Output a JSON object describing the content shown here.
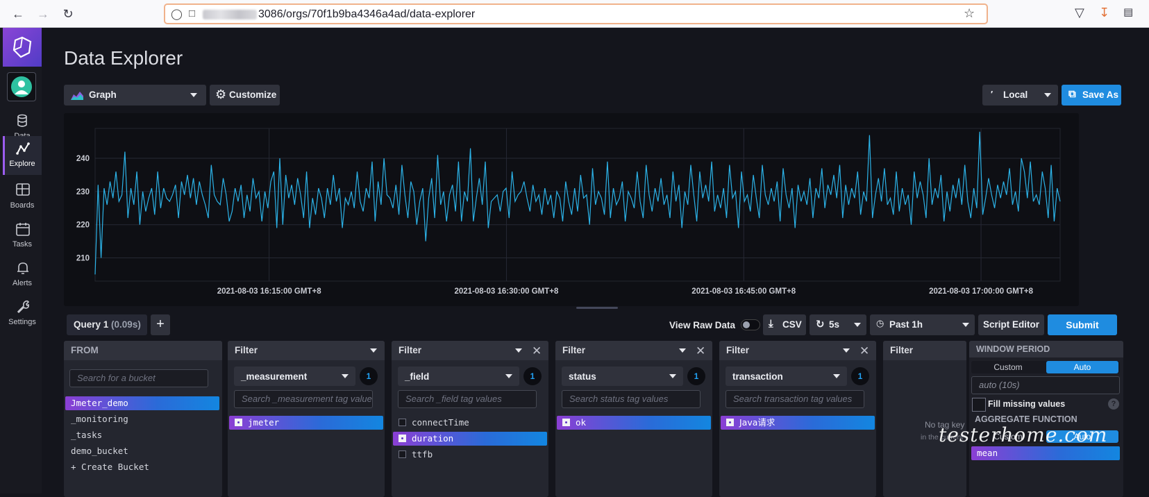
{
  "browser": {
    "url_rest": "3086/orgs/70f1b9ba4346a4ad/data-explorer"
  },
  "sidebar": {
    "items": [
      {
        "label": "Data"
      },
      {
        "label": "Explore"
      },
      {
        "label": "Boards"
      },
      {
        "label": "Tasks"
      },
      {
        "label": "Alerts"
      },
      {
        "label": "Settings"
      }
    ]
  },
  "header": {
    "title": "Data Explorer",
    "graph_type": "Graph",
    "customize": "Customize",
    "timezone": "Local",
    "save_as": "Save As"
  },
  "chart_data": {
    "type": "line",
    "y_ticks": [
      "210",
      "220",
      "230",
      "240"
    ],
    "x_ticks": [
      "2021-08-03 16:15:00 GMT+8",
      "2021-08-03 16:30:00 GMT+8",
      "2021-08-03 16:45:00 GMT+8",
      "2021-08-03 17:00:00 GMT+8"
    ],
    "ylim": [
      203,
      249
    ],
    "x_start": "2021-08-03 16:04:00 GMT+8",
    "x_end": "2021-08-03 17:05:00 GMT+8",
    "series": [
      {
        "color": "#2cb3e8",
        "values": [
          205,
          232,
          210,
          231,
          226,
          233,
          228,
          236,
          227,
          229,
          242,
          222,
          231,
          226,
          236,
          220,
          230,
          224,
          228,
          231,
          223,
          236,
          225,
          231,
          228,
          227,
          229,
          232,
          222,
          233,
          229,
          235,
          228,
          234,
          226,
          233,
          229,
          226,
          222,
          238,
          229,
          227,
          226,
          234,
          229,
          221,
          224,
          231,
          227,
          232,
          222,
          229,
          224,
          234,
          228,
          230,
          221,
          230,
          225,
          233,
          236,
          219,
          240,
          220,
          235,
          228,
          232,
          226,
          234,
          229,
          222,
          236,
          219,
          228,
          223,
          231,
          228,
          222,
          231,
          226,
          235,
          227,
          231,
          219,
          228,
          226,
          230,
          225,
          236,
          227,
          224,
          231,
          228,
          239,
          221,
          233,
          226,
          240,
          229,
          228,
          225,
          232,
          223,
          238,
          229,
          222,
          233,
          230,
          220,
          227,
          231,
          215,
          228,
          234,
          222,
          241,
          226,
          230,
          221,
          229,
          232,
          224,
          239,
          221,
          230,
          227,
          243,
          221,
          228,
          234,
          226,
          239,
          219,
          227,
          228,
          229,
          224,
          230,
          231,
          222,
          236,
          227,
          229,
          230,
          233,
          228,
          224,
          232,
          227,
          229,
          223,
          231,
          226,
          229,
          222,
          230,
          228,
          221,
          233,
          227,
          223,
          231,
          224,
          235,
          228,
          229,
          220,
          237,
          226,
          230,
          228,
          223,
          239,
          222,
          231,
          226,
          228,
          233,
          221,
          230,
          228,
          225,
          236,
          227,
          222,
          238,
          229,
          224,
          231,
          227,
          234,
          226,
          229,
          222,
          236,
          227,
          232,
          219,
          230,
          226,
          238,
          229,
          221,
          236,
          228,
          232,
          227,
          239,
          224,
          229,
          225,
          231,
          222,
          238,
          228,
          230,
          219,
          236,
          227,
          229,
          224,
          235,
          228,
          222,
          238,
          229,
          226,
          231,
          227,
          233,
          221,
          237,
          229,
          225,
          231,
          219,
          232,
          227,
          230,
          226,
          234,
          222,
          231,
          228,
          237,
          225,
          232,
          229,
          235,
          228,
          238,
          222,
          232,
          226,
          231,
          228,
          236,
          223,
          230,
          227,
          247,
          222,
          229,
          234,
          227,
          237,
          226,
          228,
          223,
          236,
          224,
          231,
          226,
          229,
          220,
          236,
          228,
          233,
          229,
          222,
          240,
          226,
          231,
          228,
          235,
          221,
          230,
          224,
          232,
          228,
          234,
          226,
          238,
          227,
          222,
          231,
          225,
          248,
          223,
          228,
          234,
          229,
          225,
          232,
          228,
          233,
          229,
          237,
          226,
          230,
          224,
          240,
          236,
          228,
          239,
          227,
          229,
          226,
          236,
          231,
          222,
          238,
          221,
          231,
          227
        ],
        "name": ""
      }
    ]
  },
  "query": {
    "tab_label": "Query 1",
    "tab_time": "(0.09s)",
    "view_raw": "View Raw Data",
    "csv": "CSV",
    "refresh": "5s",
    "range": "Past 1h",
    "script_editor": "Script Editor",
    "submit": "Submit"
  },
  "from_panel": {
    "title": "FROM",
    "search_placeholder": "Search for a bucket",
    "buckets": [
      "Jmeter_demo",
      "_monitoring",
      "_tasks",
      "demo_bucket",
      "+ Create Bucket"
    ]
  },
  "filters": [
    {
      "title": "Filter",
      "key": "_measurement",
      "count": "1",
      "placeholder": "Search _measurement tag values",
      "values": [
        {
          "label": "jmeter",
          "selected": true
        }
      ]
    },
    {
      "title": "Filter",
      "key": "_field",
      "count": "1",
      "placeholder": "Search _field tag values",
      "values": [
        {
          "label": "connectTime",
          "selected": false
        },
        {
          "label": "duration",
          "selected": true
        },
        {
          "label": "ttfb",
          "selected": false
        }
      ]
    },
    {
      "title": "Filter",
      "key": "status",
      "count": "1",
      "placeholder": "Search status tag values",
      "values": [
        {
          "label": "ok",
          "selected": true
        }
      ]
    },
    {
      "title": "Filter",
      "key": "transaction",
      "count": "1",
      "placeholder": "Search transaction tag values",
      "values": [
        {
          "label": "Java请求",
          "selected": true
        }
      ]
    }
  ],
  "filter_empty": {
    "title": "Filter",
    "msg1": "No tag key",
    "msg2": "in the current"
  },
  "window": {
    "title": "WINDOW PERIOD",
    "custom": "Custom",
    "auto": "Auto",
    "input_placeholder": "auto (10s)",
    "fill": "Fill missing values",
    "help": "?"
  },
  "aggregate": {
    "title": "AGGREGATE FUNCTION",
    "custom": "Custom",
    "auto": "Auto",
    "first": "mean"
  },
  "watermark": "testerhome.com"
}
